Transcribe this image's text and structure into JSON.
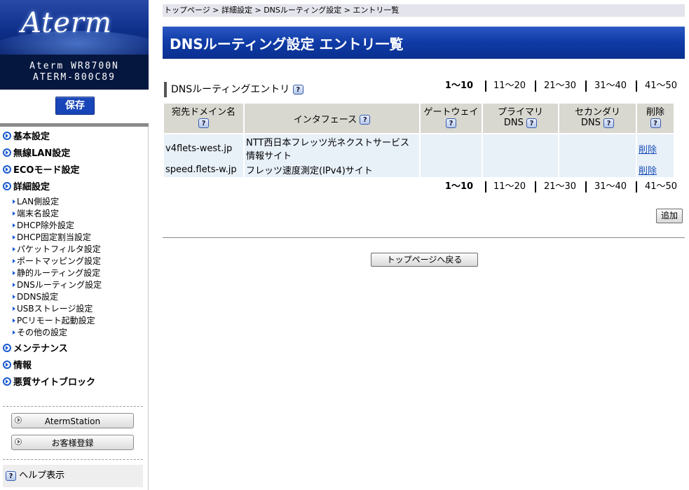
{
  "brand": {
    "logo_text": "Aterm",
    "model_line1": "Aterm WR8700N",
    "model_line2": "ATERM-800C89"
  },
  "sidebar": {
    "save_label": "保存",
    "nav": [
      {
        "label": "基本設定"
      },
      {
        "label": "無線LAN設定"
      },
      {
        "label": "ECOモード設定"
      },
      {
        "label": "詳細設定"
      }
    ],
    "sub": [
      {
        "label": "LAN側設定"
      },
      {
        "label": "端末名設定"
      },
      {
        "label": "DHCP除外設定"
      },
      {
        "label": "DHCP固定割当設定"
      },
      {
        "label": "パケットフィルタ設定"
      },
      {
        "label": "ポートマッピング設定"
      },
      {
        "label": "静的ルーティング設定"
      },
      {
        "label": "DNSルーティング設定"
      },
      {
        "label": "DDNS設定"
      },
      {
        "label": "USBストレージ設定"
      },
      {
        "label": "PCリモート起動設定"
      },
      {
        "label": "その他の設定"
      }
    ],
    "nav2": [
      {
        "label": "メンテナンス"
      },
      {
        "label": "情報"
      },
      {
        "label": "悪質サイトブロック"
      }
    ],
    "buttons": {
      "atermstation": "AtermStation",
      "register": "お客様登録"
    },
    "help_label": "ヘルプ表示",
    "help_icon": "?"
  },
  "breadcrumb": "トップページ > 詳細設定 > DNSルーティング設定 > エントリ一覧",
  "page_title": "DNSルーティング設定 エントリ一覧",
  "section_title": "DNSルーティングエントリ",
  "pager": [
    "1〜10",
    "11〜20",
    "21〜30",
    "31〜40",
    "41〜50"
  ],
  "table": {
    "headers": {
      "domain": "宛先ドメイン名",
      "interface": "インタフェース",
      "gateway": "ゲートウェイ",
      "primary_1": "プライマリ",
      "primary_2": "DNS",
      "secondary_1": "セカンダリ",
      "secondary_2": "DNS",
      "delete": "削除"
    },
    "rows": [
      {
        "domain": "v4flets-west.jp",
        "interface": "NTT西日本フレッツ光ネクストサービス情報サイト",
        "gateway": "",
        "primary": "",
        "secondary": "",
        "delete": "削除"
      },
      {
        "domain": "speed.flets-w.jp",
        "interface": "フレッツ速度測定(IPv4)サイト",
        "gateway": "",
        "primary": "",
        "secondary": "",
        "delete": "削除"
      }
    ]
  },
  "add_label": "追加",
  "back_label": "トップページへ戻る",
  "colors": {
    "title_blue": "#0f3aa6",
    "model_bg": "#06173f",
    "link": "#1a4fb8"
  }
}
